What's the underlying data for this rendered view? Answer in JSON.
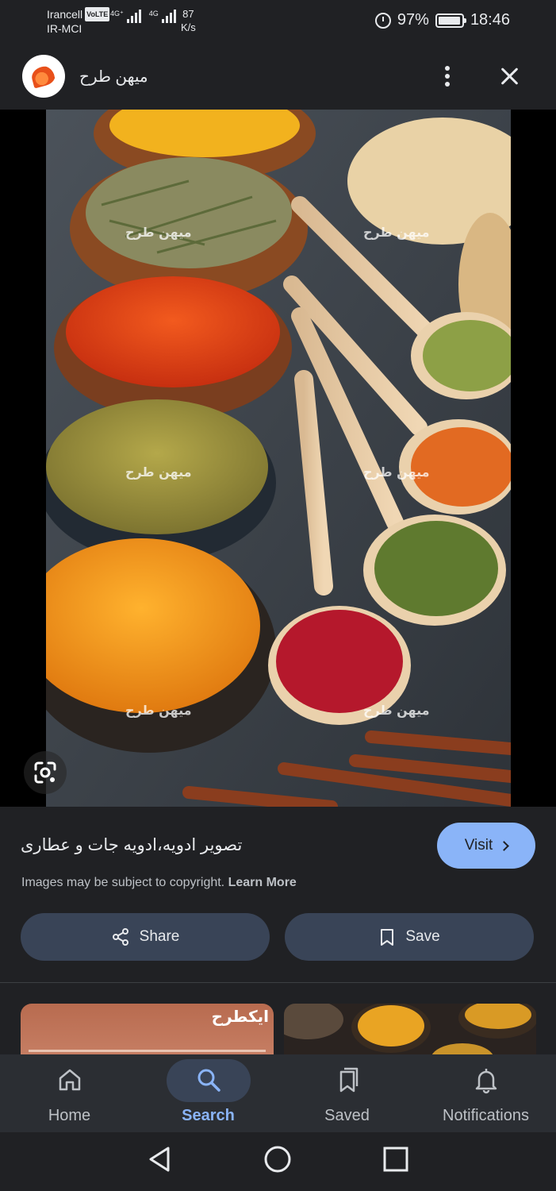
{
  "status_bar": {
    "carrier_1": "Irancell",
    "volte": "VoLTE",
    "carrier_2": "IR-MCI",
    "sig1_label": "4G⁺",
    "sig2_label": "4G",
    "speed_value": "87",
    "speed_unit": "K/s",
    "battery": "97%",
    "time": "18:46",
    "battery_level": 0.97
  },
  "header": {
    "site_name": "میهن طرح",
    "site_icon": "flame-logo-icon",
    "more_icon": "more-vert-icon",
    "close_icon": "close-icon"
  },
  "image": {
    "watermark": "میهن طرح",
    "lens_icon": "google-lens-icon"
  },
  "info": {
    "title": "تصویر ادویه،ادویه جات و عطاری",
    "visit_label": "Visit",
    "copyright_text": "Images may be subject to copyright.",
    "learn_more": "Learn More",
    "share_label": "Share",
    "save_label": "Save"
  },
  "thumbnails": {
    "thumb1_watermark": "ایکطرح"
  },
  "bottom_nav": {
    "items": [
      {
        "label": "Home",
        "icon": "home-icon"
      },
      {
        "label": "Search",
        "icon": "search-icon",
        "active": true
      },
      {
        "label": "Saved",
        "icon": "saved-icon"
      },
      {
        "label": "Notifications",
        "icon": "bell-icon"
      }
    ]
  },
  "colors": {
    "background": "#202124",
    "accent": "#8ab4f8",
    "pill": "#394457",
    "nav_bar": "#2b2e33"
  }
}
